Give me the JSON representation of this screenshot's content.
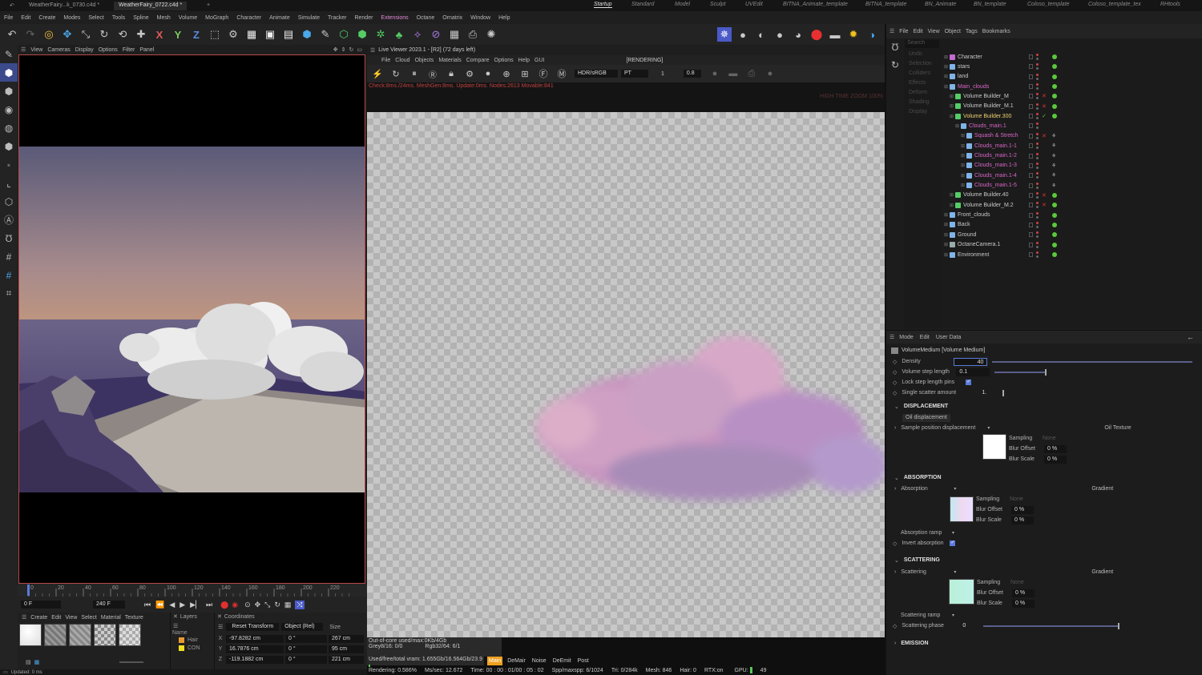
{
  "file_tabs": [
    {
      "label": "WeatherFairy...k_0730.c4d *",
      "active": false
    },
    {
      "label": "WeatherFairy_0722.c4d *",
      "active": true
    }
  ],
  "layout_tabs": [
    {
      "label": "Startup",
      "active": true
    },
    {
      "label": "Standard"
    },
    {
      "label": "Model"
    },
    {
      "label": "Sculpt"
    },
    {
      "label": "UVEdit"
    },
    {
      "label": "BITNA_Animate_template"
    },
    {
      "label": "BITNA_template"
    },
    {
      "label": "BN_Animate"
    },
    {
      "label": "BN_template"
    },
    {
      "label": "Coloso_template"
    },
    {
      "label": "Coloso_template_tex"
    },
    {
      "label": "RHtools"
    }
  ],
  "menu": [
    "File",
    "Edit",
    "Create",
    "Modes",
    "Select",
    "Tools",
    "Spline",
    "Mesh",
    "Volume",
    "MoGraph",
    "Character",
    "Animate",
    "Simulate",
    "Tracker",
    "Render",
    "Extensions",
    "Octane",
    "Ornatrix",
    "Window",
    "Help"
  ],
  "menu_highlight": "Extensions",
  "viewport_menu": [
    "View",
    "Cameras",
    "Display",
    "Options",
    "Filter",
    "Panel"
  ],
  "timeline": {
    "ticks": [
      "0",
      "20",
      "40",
      "60",
      "80",
      "100",
      "120",
      "140",
      "160",
      "180",
      "200",
      "220"
    ],
    "start": "0 F",
    "end": "240 F"
  },
  "material_menu": [
    "Create",
    "Edit",
    "View",
    "Select",
    "Material",
    "Texture"
  ],
  "layers": {
    "title": "Layers",
    "col": "Name",
    "items": [
      "Hair",
      "CON"
    ]
  },
  "coordinates": {
    "title": "Coordinates",
    "reset": "Reset Transform",
    "mode": "Object (Rel)",
    "size": "Size",
    "rows": [
      {
        "axis": "X",
        "pos": "-97.8282 cm",
        "rot": "0 °",
        "size": "267 cm"
      },
      {
        "axis": "Y",
        "pos": "16.7876 cm",
        "rot": "0 °",
        "size": "95 cm"
      },
      {
        "axis": "Z",
        "pos": "-119.1882 cm",
        "rot": "0 °",
        "size": "221 cm"
      }
    ]
  },
  "live_viewer": {
    "title": "Live Viewer 2023.1 - [R2] (72 days left)",
    "menu": [
      "File",
      "Cloud",
      "Objects",
      "Materials",
      "Compare",
      "Options",
      "Help",
      "GUI"
    ],
    "status": "[RENDERING]",
    "colorspace": "HDR/sRGB",
    "kernel": "PT",
    "val1": "1",
    "val2": "0.8",
    "info": "Check:8ms./24ms. MeshGen:8ms. Update:0ms. Nodes:2613 Movable:841",
    "info_right": "HIGH TIME ZOOM 100%"
  },
  "lv_stats": {
    "vram": "Out-of-core used/max:0Kb/4Gb",
    "grey": "Grey8/16: 0/0",
    "rgb": "Rgb32/64: 6/1",
    "used": "Used/free/total vram: 1.655Gb/16.564Gb/23.9",
    "tabs": [
      "Main",
      "DeMair",
      "Noise",
      "DeEmit",
      "Post"
    ],
    "rendering": "Rendering: 0.586%",
    "ms": "Ms/sec: 12.672",
    "time": "Time: 00 : 00 : 01/00 : 05 : 02",
    "spp": "Spp/maxspp: 6/1024",
    "tri": "Tri: 0/284k",
    "mesh": "Mesh: 846",
    "hair": "Hair: 0",
    "rtx": "RTX:on",
    "gpu": "GPU:",
    "gpu_val": "49"
  },
  "om_menu": [
    "File",
    "Edit",
    "View",
    "Object",
    "Tags",
    "Bookmarks"
  ],
  "om_search": "Search",
  "om_side": [
    "Undo",
    "Selection",
    "Colliders",
    "Effects",
    "Deform",
    "Shading",
    "Display"
  ],
  "objects": [
    {
      "name": "Character",
      "indent": 0,
      "style": "",
      "icon": "#c56ad0"
    },
    {
      "name": "stars",
      "indent": 0,
      "style": "",
      "icon": "#7fb4e8"
    },
    {
      "name": "land",
      "indent": 0,
      "style": "",
      "icon": "#7fb4e8"
    },
    {
      "name": "Main_clouds",
      "indent": 0,
      "style": "pink",
      "icon": "#7fb4e8"
    },
    {
      "name": "Volume Builder_M",
      "indent": 1,
      "style": "",
      "icon": "#55cc66"
    },
    {
      "name": "Volume Builder_M.1",
      "indent": 1,
      "style": "",
      "icon": "#55cc66"
    },
    {
      "name": "Volume Builder.300",
      "indent": 1,
      "style": "sel",
      "icon": "#55cc66"
    },
    {
      "name": "Clouds_main.1",
      "indent": 2,
      "style": "pink",
      "icon": "#7fb4e8"
    },
    {
      "name": "Squash & Stretch",
      "indent": 3,
      "style": "pink",
      "icon": "#7fb4e8"
    },
    {
      "name": "Clouds_main.1-1",
      "indent": 3,
      "style": "pink",
      "icon": "#7fb4e8"
    },
    {
      "name": "Clouds_main.1-2",
      "indent": 3,
      "style": "pink",
      "icon": "#7fb4e8"
    },
    {
      "name": "Clouds_main.1-3",
      "indent": 3,
      "style": "pink",
      "icon": "#7fb4e8"
    },
    {
      "name": "Clouds_main.1-4",
      "indent": 3,
      "style": "pink",
      "icon": "#7fb4e8"
    },
    {
      "name": "Clouds_main.1-5",
      "indent": 3,
      "style": "pink",
      "icon": "#7fb4e8"
    },
    {
      "name": "Volume Builder.40",
      "indent": 1,
      "style": "",
      "icon": "#55cc66"
    },
    {
      "name": "Volume Builder_M.2",
      "indent": 1,
      "style": "",
      "icon": "#55cc66"
    },
    {
      "name": "Front_clouds",
      "indent": 0,
      "style": "",
      "icon": "#7fb4e8"
    },
    {
      "name": "Back",
      "indent": 0,
      "style": "",
      "icon": "#7fb4e8"
    },
    {
      "name": "Ground",
      "indent": 0,
      "style": "",
      "icon": "#7fb4e8"
    },
    {
      "name": "OctaneCamera.1",
      "indent": 0,
      "style": "",
      "icon": "#9aa"
    },
    {
      "name": "Environment",
      "indent": 0,
      "style": "",
      "icon": "#7fb4e8"
    }
  ],
  "am_menu": [
    "Mode",
    "Edit",
    "User Data"
  ],
  "am": {
    "title": "VolumeMedium [Volume Medium]",
    "density_label": "Density",
    "density_value": "40",
    "step_label": "Volume step length",
    "step_value": "0.1",
    "lock_label": "Lock step length pins",
    "scatter_label": "Single scatter amount",
    "scatter_value": "1.",
    "disp_section": "DISPLACEMENT",
    "disp_tab": "Oil displacement",
    "sample_label": "Sample position displacement",
    "oil_texture": "Oil Texture",
    "sampling": "Sampling",
    "none": "None",
    "blur_offset": "Blur Offset",
    "blur_scale": "Blur Scale",
    "pct": "0 %",
    "abs_section": "ABSORPTION",
    "abs_label": "Absorption",
    "gradient": "Gradient",
    "abs_ramp": "Absorption ramp",
    "invert_abs": "Invert absorption",
    "scat_section": "SCATTERING",
    "scat_label": "Scattering",
    "scat_ramp": "Scattering ramp",
    "scat_phase": "Scattering phase",
    "scat_phase_value": "0",
    "emission": "EMISSION"
  },
  "status_bar": "Updated: 0 ms"
}
